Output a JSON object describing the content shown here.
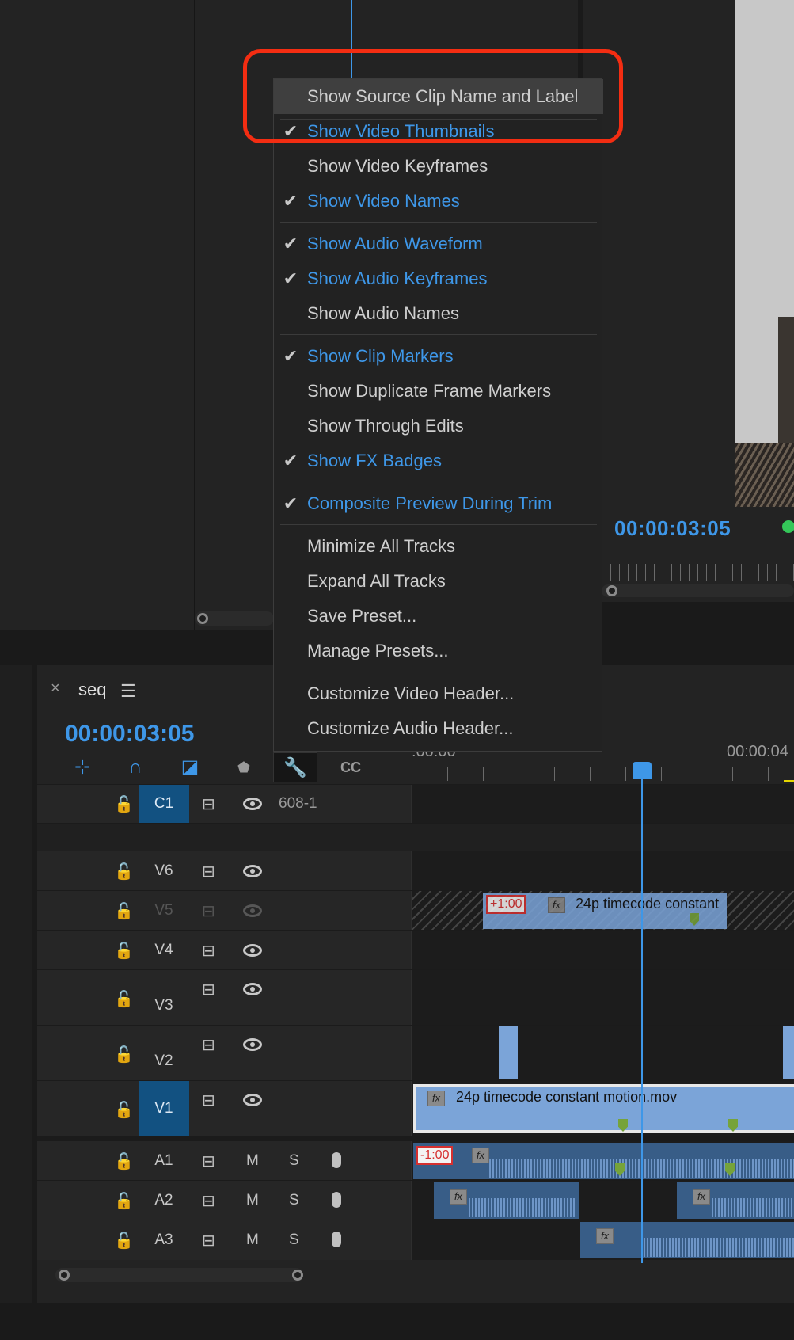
{
  "source_monitor": {
    "playhead_visible": true
  },
  "program_monitor": {
    "timecode": "00:00:03:05"
  },
  "context_menu": {
    "highlighted_index": 0,
    "items": [
      {
        "label": "Show Source Clip Name and Label",
        "checked": false
      },
      {
        "label": "Show Video Thumbnails",
        "checked": true
      },
      {
        "label": "Show Video Keyframes",
        "checked": false
      },
      {
        "label": "Show Video Names",
        "checked": true
      },
      {
        "label": "Show Audio Waveform",
        "checked": true
      },
      {
        "label": "Show Audio Keyframes",
        "checked": true
      },
      {
        "label": "Show Audio Names",
        "checked": false
      },
      {
        "label": "Show Clip Markers",
        "checked": true
      },
      {
        "label": "Show Duplicate Frame Markers",
        "checked": false
      },
      {
        "label": "Show Through Edits",
        "checked": false
      },
      {
        "label": "Show FX Badges",
        "checked": true
      },
      {
        "label": "Composite Preview During Trim",
        "checked": true
      },
      {
        "label": "Minimize All Tracks",
        "checked": false
      },
      {
        "label": "Expand All Tracks",
        "checked": false
      },
      {
        "label": "Save Preset...",
        "checked": false
      },
      {
        "label": "Manage Presets...",
        "checked": false
      },
      {
        "label": "Customize Video Header...",
        "checked": false
      },
      {
        "label": "Customize Audio Header...",
        "checked": false
      }
    ],
    "check_glyph": "✔"
  },
  "timeline": {
    "tab": {
      "close": "×",
      "title": "seq",
      "menu": "☰"
    },
    "timecode": "00:00:03:05",
    "ruler_labels": [
      ":00:00",
      "00:00:04"
    ],
    "tools": [
      {
        "icon": "snap-insert-icon",
        "glyph": "⊹"
      },
      {
        "icon": "magnet-icon",
        "glyph": "∩"
      },
      {
        "icon": "linked-selection-icon",
        "glyph": "◪"
      },
      {
        "icon": "add-marker-icon",
        "glyph": "⬟"
      },
      {
        "icon": "wrench-icon",
        "glyph": "🔧"
      },
      {
        "icon": "captions-icon",
        "glyph": "CC"
      }
    ],
    "tracks": {
      "C1": {
        "name": "C1",
        "label": "608-1"
      },
      "V6": {
        "name": "V6"
      },
      "V5": {
        "name": "V5"
      },
      "V4": {
        "name": "V4"
      },
      "V3": {
        "name": "V3"
      },
      "V2": {
        "name": "V2"
      },
      "V1": {
        "name": "V1"
      },
      "A1": {
        "name": "A1",
        "m": "M",
        "s": "S"
      },
      "A2": {
        "name": "A2",
        "m": "M",
        "s": "S"
      },
      "A3": {
        "name": "A3",
        "m": "M",
        "s": "S"
      }
    },
    "clips": {
      "v5_speed": "+1:00",
      "v5_name": "24p timecode constant",
      "v1_name": "24p timecode constant motion.mov",
      "a1_speed": "-1:00",
      "fx": "fx"
    },
    "lock_glyph": "🔓",
    "header_icon_glyph": "⊟"
  },
  "colors": {
    "accent_blue": "#3e97e8",
    "highlight_box": "#f32d12",
    "video_clip": "#7ba4d8",
    "audio_clip": "#385d87",
    "active_track": "#125181"
  }
}
